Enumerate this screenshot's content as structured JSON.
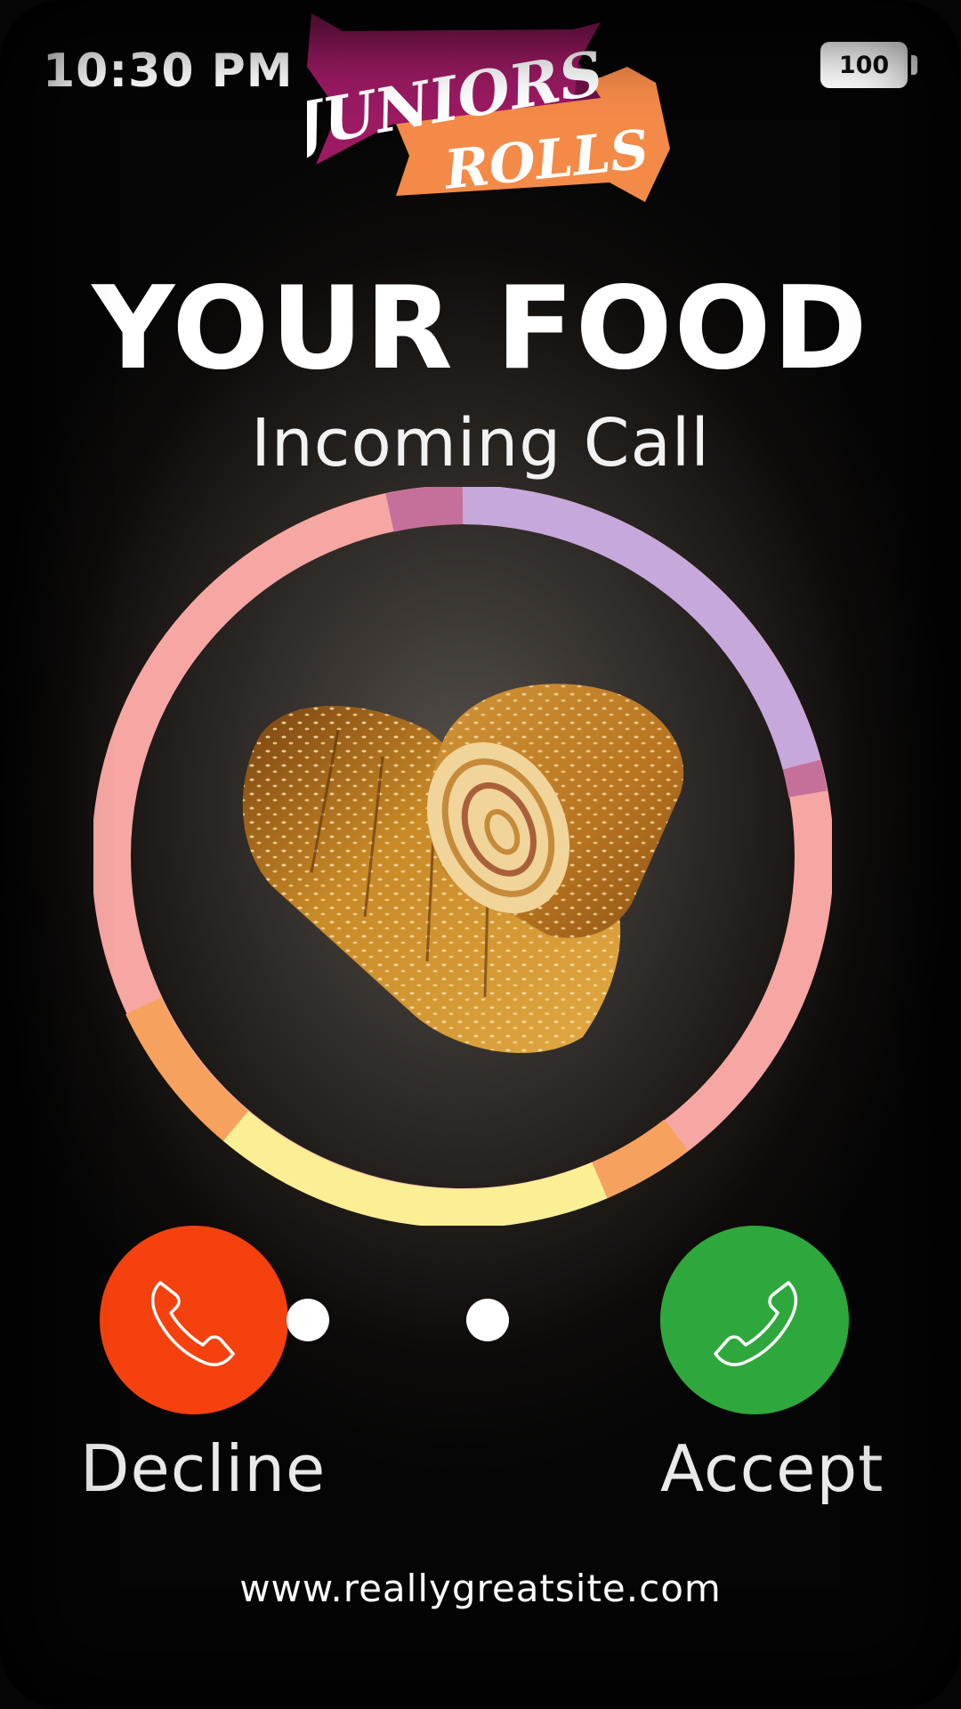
{
  "status_bar": {
    "time": "10:30 PM",
    "battery": "100"
  },
  "logo": {
    "line1": "JUNIORS",
    "line2": "ROLLS",
    "colors": {
      "banner_top": "#9b1a62",
      "banner_bottom": "#f48a48"
    }
  },
  "call": {
    "title": "YOUR FOOD",
    "subtitle": "Incoming  Call"
  },
  "ring_colors": [
    "#c7a8dd",
    "#c5709a",
    "#f7a7a3",
    "#f7a15e",
    "#fbef96"
  ],
  "buttons": {
    "decline": {
      "label": "Decline",
      "color": "#f5410e",
      "icon": "phone-handset-icon"
    },
    "accept": {
      "label": "Accept",
      "color": "#2ea83c",
      "icon": "phone-handset-icon"
    }
  },
  "footer": {
    "website": "www.reallygreatsite.com"
  }
}
